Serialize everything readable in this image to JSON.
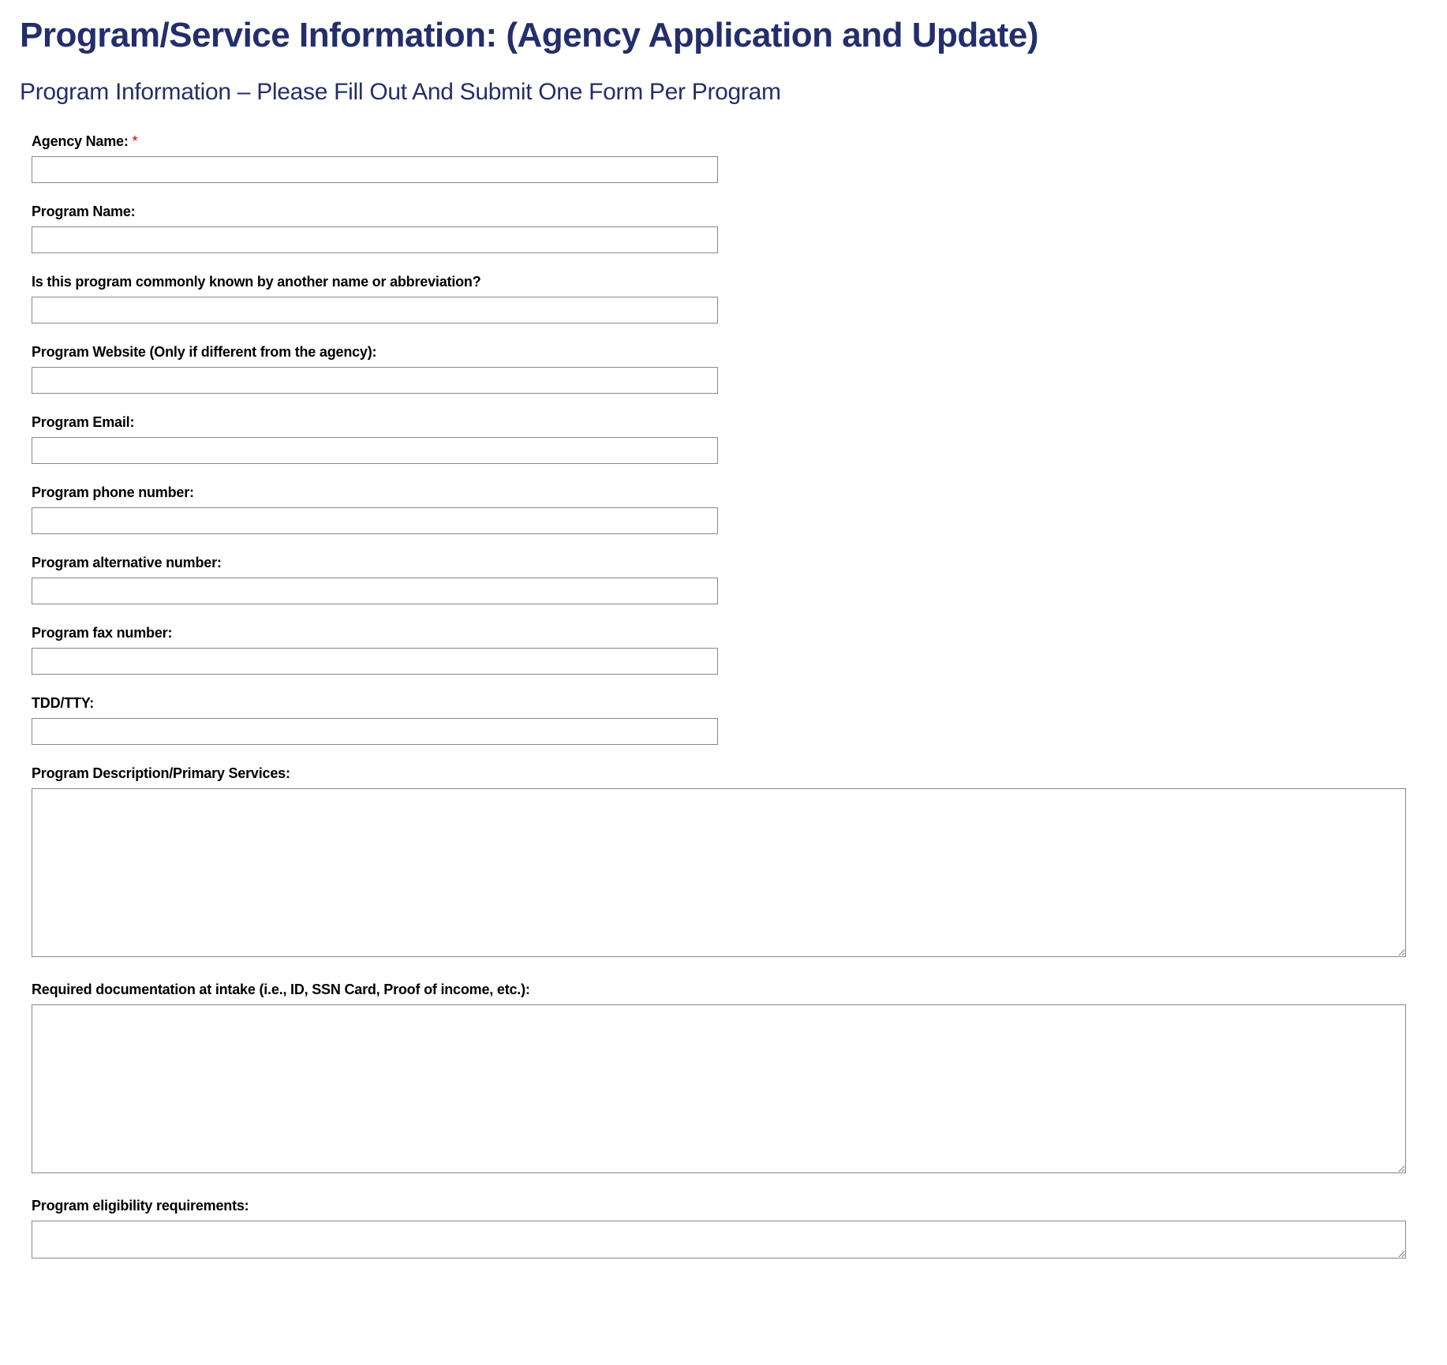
{
  "header": {
    "title": "Program/Service Information: (Agency Application and Update)",
    "subtitle": "Program Information – Please Fill Out And Submit One Form Per Program"
  },
  "form": {
    "fields": [
      {
        "label": "Agency Name:",
        "required": true,
        "type": "text",
        "value": ""
      },
      {
        "label": "Program Name:",
        "required": false,
        "type": "text",
        "value": ""
      },
      {
        "label": "Is this program commonly known by another name or abbreviation?",
        "required": false,
        "type": "text",
        "value": ""
      },
      {
        "label": "Program Website (Only if different from the agency):",
        "required": false,
        "type": "text",
        "value": ""
      },
      {
        "label": "Program Email:",
        "required": false,
        "type": "text",
        "value": ""
      },
      {
        "label": "Program phone number:",
        "required": false,
        "type": "text",
        "value": ""
      },
      {
        "label": "Program alternative number:",
        "required": false,
        "type": "text",
        "value": ""
      },
      {
        "label": "Program fax number:",
        "required": false,
        "type": "text",
        "value": ""
      },
      {
        "label": "TDD/TTY:",
        "required": false,
        "type": "text",
        "value": ""
      },
      {
        "label": "Program Description/Primary Services:",
        "required": false,
        "type": "textarea",
        "value": ""
      },
      {
        "label": "Required documentation at intake (i.e., ID, SSN Card, Proof of income, etc.):",
        "required": false,
        "type": "textarea",
        "value": ""
      },
      {
        "label": "Program eligibility requirements:",
        "required": false,
        "type": "textarea-short",
        "value": ""
      }
    ],
    "required_mark": "*"
  }
}
